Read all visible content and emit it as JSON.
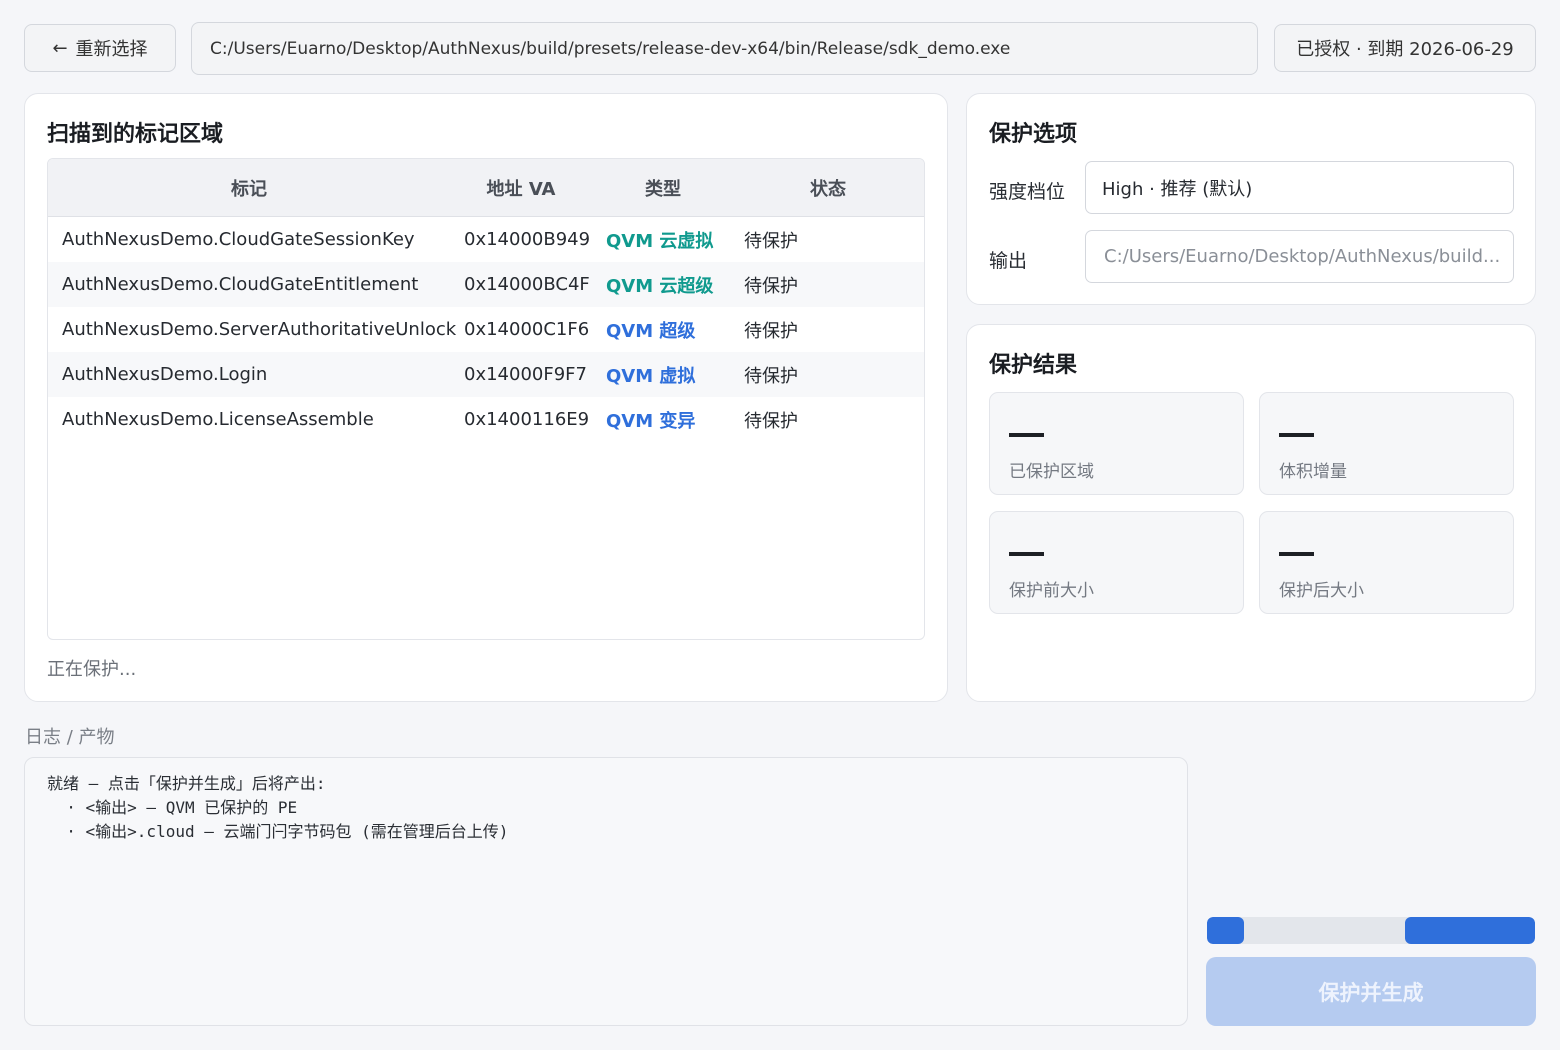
{
  "header": {
    "back_label": "重新选择",
    "back_arrow": "←",
    "path": "C:/Users/Euarno/Desktop/AuthNexus/build/presets/release-dev-x64/bin/Release/sdk_demo.exe",
    "license": "已授权 · 到期 2026-06-29"
  },
  "regions": {
    "title": "扫描到的标记区域",
    "columns": [
      "标记",
      "地址 VA",
      "类型",
      "状态"
    ],
    "rows": [
      {
        "mark": "AuthNexusDemo.CloudGateSessionKey",
        "addr": "0x14000B949",
        "type": "QVM 云虚拟",
        "status": "待保护",
        "type_color": "#109a8e"
      },
      {
        "mark": "AuthNexusDemo.CloudGateEntitlement",
        "addr": "0x14000BC4F",
        "type": "QVM 云超级",
        "status": "待保护",
        "type_color": "#109a8e"
      },
      {
        "mark": "AuthNexusDemo.ServerAuthoritativeUnlock",
        "addr": "0x14000C1F6",
        "type": "QVM 超级",
        "status": "待保护",
        "type_color": "#2f6fdb"
      },
      {
        "mark": "AuthNexusDemo.Login",
        "addr": "0x14000F9F7",
        "type": "QVM 虚拟",
        "status": "待保护",
        "type_color": "#2f6fdb"
      },
      {
        "mark": "AuthNexusDemo.LicenseAssemble",
        "addr": "0x1400116E9",
        "type": "QVM 变异",
        "status": "待保护",
        "type_color": "#2f6fdb"
      }
    ],
    "progress_text": "正在保护..."
  },
  "options": {
    "title": "保护选项",
    "strength_label": "强度档位",
    "strength_value": "High · 推荐 (默认)",
    "output_label": "输出",
    "output_placeholder": "C:/Users/Euarno/Desktop/AuthNexus/build..."
  },
  "result": {
    "title": "保护结果",
    "stats": [
      {
        "value": "—",
        "label": "已保护区域"
      },
      {
        "value": "—",
        "label": "体积增量"
      },
      {
        "value": "—",
        "label": "保护前大小"
      },
      {
        "value": "—",
        "label": "保护后大小"
      }
    ]
  },
  "log": {
    "label": "日志 / 产物",
    "lines": [
      "就绪 — 点击「保护并生成」后将产出:",
      "  · <输出> — QVM 已保护的 PE",
      "  · <输出>.cloud — 云端门闩字节码包 (需在管理后台上传)"
    ]
  },
  "action": {
    "protect_label": "保护并生成"
  },
  "colors": {
    "accent": "#2f6fdb",
    "cloud": "#109a8e",
    "button_disabled": "#b5cbf0"
  }
}
